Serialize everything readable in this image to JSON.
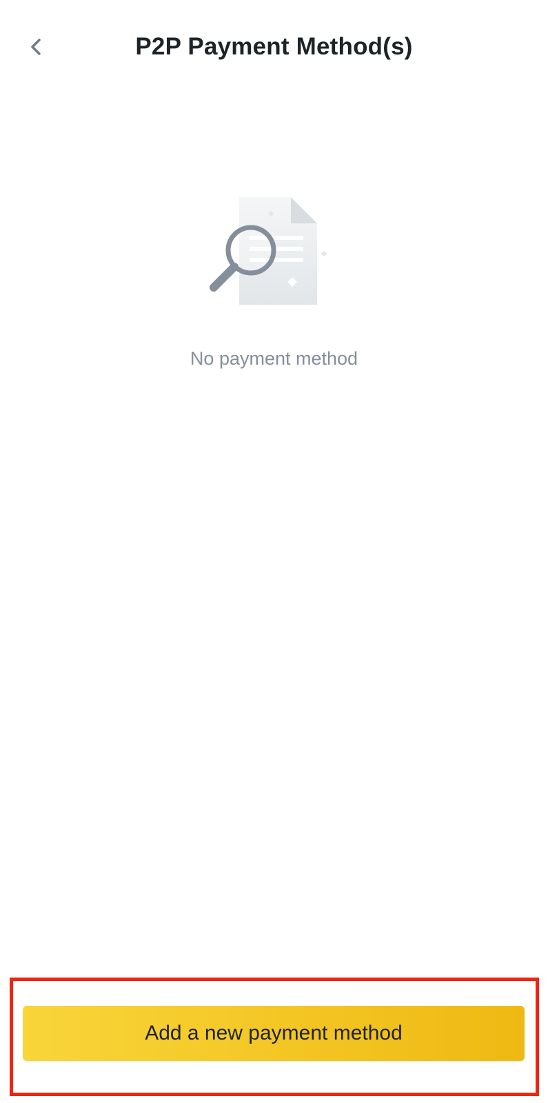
{
  "header": {
    "back_icon": "chevron-left-icon",
    "title": "P2P Payment Method(s)"
  },
  "empty_state": {
    "illustration_icon": "document-search-icon",
    "message": "No payment method"
  },
  "footer": {
    "add_button_label": "Add a new payment method",
    "highlight_color": "#f0250f",
    "button_color": "#f3c421"
  },
  "colors": {
    "title_text": "#1e2329",
    "muted_text": "#848e9c",
    "icon_gray": "#707a8a"
  }
}
